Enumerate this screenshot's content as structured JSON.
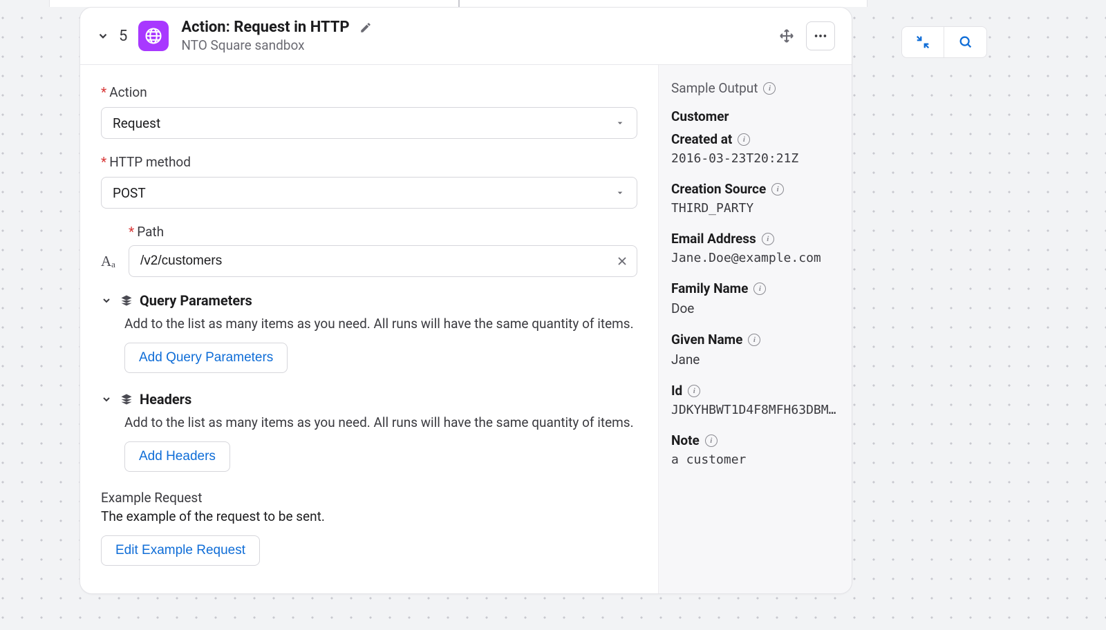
{
  "header": {
    "step_number": "5",
    "title": "Action: Request in HTTP",
    "subtitle": "NTO Square sandbox"
  },
  "form": {
    "action_label": "Action",
    "action_value": "Request",
    "method_label": "HTTP method",
    "method_value": "POST",
    "path_label": "Path",
    "path_value": "/v2/customers",
    "query_section_title": "Query Parameters",
    "query_section_desc": "Add to the list as many items as you need. All runs will have the same quantity of items.",
    "query_add_button": "Add Query Parameters",
    "headers_section_title": "Headers",
    "headers_section_desc": "Add to the list as many items as you need. All runs will have the same quantity of items.",
    "headers_add_button": "Add Headers",
    "example_label": "Example Request",
    "example_desc": "The example of the request to be sent.",
    "example_button": "Edit Example Request"
  },
  "output": {
    "title": "Sample Output",
    "customer_label": "Customer",
    "created_at_label": "Created at",
    "created_at_value": "2016-03-23T20:21Z",
    "creation_source_label": "Creation Source",
    "creation_source_value": "THIRD_PARTY",
    "email_label": "Email Address",
    "email_value": "Jane.Doe@example.com",
    "family_name_label": "Family Name",
    "family_name_value": "Doe",
    "given_name_label": "Given Name",
    "given_name_value": "Jane",
    "id_label": "Id",
    "id_value": "JDKYHBWT1D4F8MFH63DBME…",
    "note_label": "Note",
    "note_value": "a customer"
  }
}
